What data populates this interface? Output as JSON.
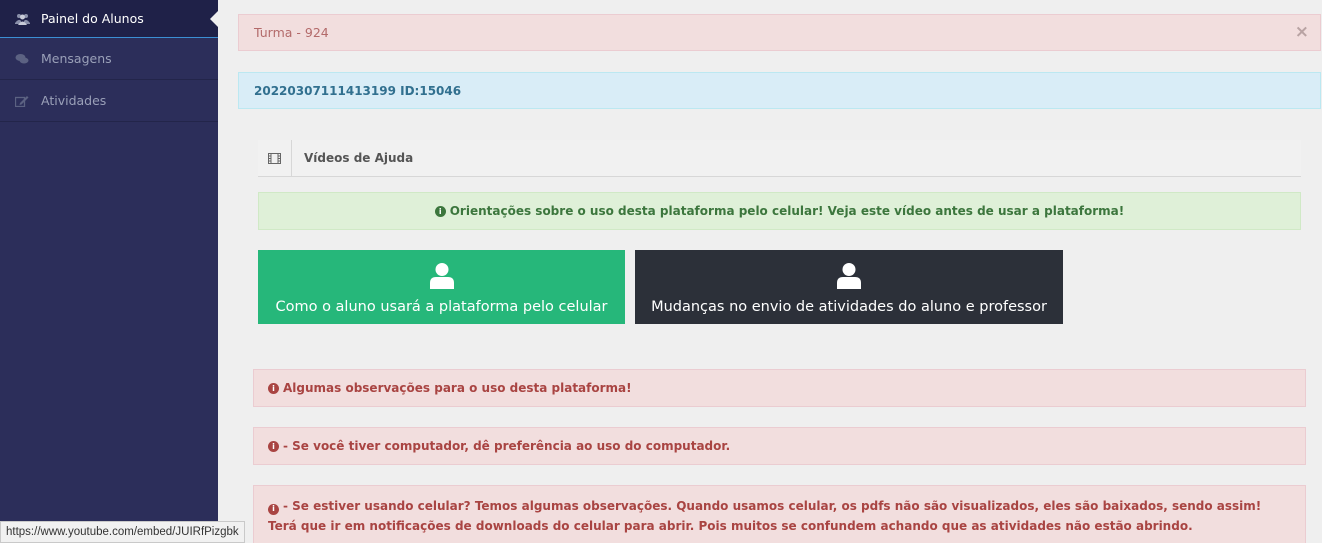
{
  "sidebar": {
    "items": [
      {
        "label": "Painel do Alunos",
        "icon": "users-icon",
        "active": true
      },
      {
        "label": "Mensagens",
        "icon": "comments-icon",
        "active": false
      },
      {
        "label": "Atividades",
        "icon": "edit-icon",
        "active": false
      }
    ]
  },
  "alerts": {
    "turma": "Turma - 924",
    "close": "×",
    "id_line": "20220307111413199 ID:15046"
  },
  "help_panel": {
    "title": "Vídeos de Ajuda",
    "orientation": "Orientações sobre o uso desta plataforma pelo celular! Veja este vídeo antes de usar a plataforma!",
    "buttons": [
      {
        "label": "Como o aluno usará a plataforma pelo celular",
        "color": "#26b77a"
      },
      {
        "label": "Mudanças no envio de atividades do aluno e professor",
        "color": "#2c3039"
      }
    ]
  },
  "observations": [
    "Algumas observações para o uso desta plataforma!",
    "- Se você tiver computador, dê preferência ao uso do computador.",
    "- Se estiver usando celular? Temos algumas observações. Quando usamos celular, os pdfs não são visualizados, eles são baixados, sendo assim! Terá que ir em notificações de downloads do celular para abrir. Pois muitos se confundem achando que as atividades não estão abrindo."
  ],
  "status_bar": {
    "url": "https://www.youtube.com/embed/JUIRfPizgbk"
  },
  "colors": {
    "sidebar_bg": "#2c2e5a",
    "danger_bg": "#f2dede",
    "info_bg": "#d9edf7",
    "success_bg": "#dff0d8"
  }
}
